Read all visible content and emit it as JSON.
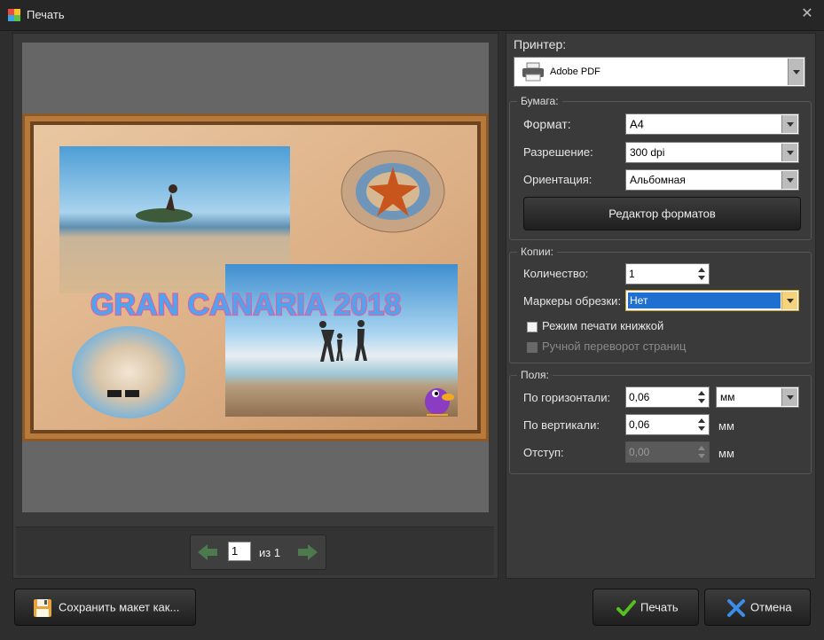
{
  "window": {
    "title": "Печать"
  },
  "preview": {
    "collage_title": "GRAN CANARIA 2018",
    "pager": {
      "current_page": "1",
      "of_label": "из 1"
    }
  },
  "printer": {
    "label": "Принтер:",
    "selected": "Adobe PDF"
  },
  "paper": {
    "group_label": "Бумага:",
    "format_label": "Формат:",
    "format_value": "А4",
    "resolution_label": "Разрешение:",
    "resolution_value": "300 dpi",
    "orientation_label": "Ориентация:",
    "orientation_value": "Альбомная",
    "format_editor_button": "Редактор форматов"
  },
  "copies": {
    "group_label": "Копии:",
    "count_label": "Количество:",
    "count_value": "1",
    "crop_marks_label": "Маркеры обрезки:",
    "crop_marks_value": "Нет",
    "book_mode_label": "Режим печати книжкой",
    "manual_flip_label": "Ручной переворот страниц"
  },
  "margins": {
    "group_label": "Поля:",
    "horizontal_label": "По горизонтали:",
    "horizontal_value": "0,06",
    "vertical_label": "По вертикали:",
    "vertical_value": "0,06",
    "indent_label": "Отступ:",
    "indent_value": "0,00",
    "unit_select": "мм",
    "unit_label_vertical": "мм",
    "unit_label_indent": "мм"
  },
  "footer": {
    "save_layout_button": "Сохранить макет как...",
    "print_button": "Печать",
    "cancel_button": "Отмена"
  },
  "colors": {
    "accent_selection": "#1f6fd1",
    "dialog_bg": "#3a3a3a",
    "print_check": "#55c021",
    "cancel_x": "#3d8ce8"
  }
}
